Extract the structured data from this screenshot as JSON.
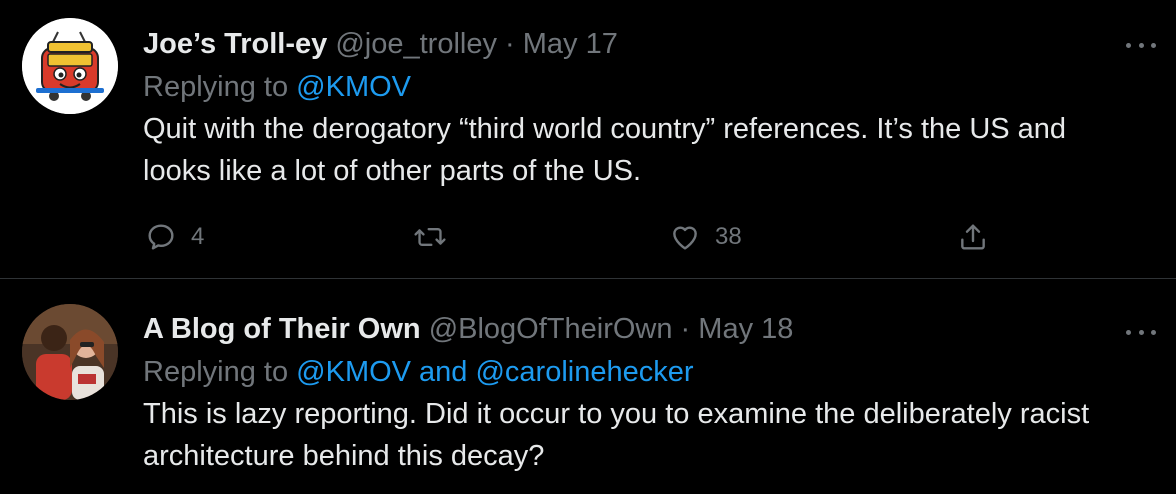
{
  "tweets": [
    {
      "author_name": "Joe’s Troll-ey",
      "handle": "@joe_trolley",
      "date": "May 17",
      "replying_prefix": "Replying to",
      "replying_to": "@KMOV",
      "text_line1": "Quit with the derogatory “third world country” references. It’s the US and",
      "text_line2": "looks like a lot of other parts of the US.",
      "reply_count": "4",
      "like_count": "38",
      "avatar_icon": "trolley-cartoon-icon"
    },
    {
      "author_name": "A Blog of Their Own",
      "handle": "@BlogOfTheirOwn",
      "date": "May 18",
      "replying_prefix": "Replying to",
      "replying_to": "@KMOV and @carolinehecker",
      "text_line1": "This is lazy reporting. Did it occur to you to examine the deliberately racist",
      "text_line2": "architecture behind this decay?",
      "avatar_icon": "photo-avatar"
    }
  ],
  "separator": "·",
  "colors": {
    "background": "#000000",
    "text": "#e7e9ea",
    "muted": "#71767b",
    "mention": "#1d9bf0"
  }
}
